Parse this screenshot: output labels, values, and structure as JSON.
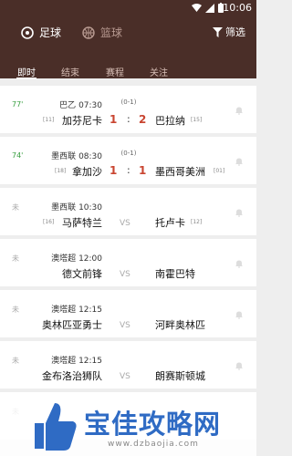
{
  "status_bar": {
    "time": "10:06"
  },
  "header": {
    "sports": [
      {
        "label": "足球",
        "active": true
      },
      {
        "label": "篮球",
        "active": false
      }
    ],
    "filter_label": "筛选"
  },
  "tabs": [
    {
      "label": "即时",
      "active": true
    },
    {
      "label": "结束",
      "active": false
    },
    {
      "label": "赛程",
      "active": false
    },
    {
      "label": "关注",
      "active": false
    }
  ],
  "matches": [
    {
      "status": "77'",
      "live": true,
      "league": "巴乙",
      "time": "07:30",
      "half_score": "(0-1)",
      "home_rank": "[11]",
      "home": "加芬尼卡",
      "home_score": "1",
      "away_score": "2",
      "away": "巴拉纳",
      "away_rank": "[15]"
    },
    {
      "status": "74'",
      "live": true,
      "league": "墨西联",
      "time": "08:30",
      "half_score": "(0-1)",
      "home_rank": "[18]",
      "home": "拿加沙",
      "home_score": "1",
      "away_score": "1",
      "away": "墨西哥美洲",
      "away_rank": "[01]"
    },
    {
      "status": "未",
      "live": false,
      "league": "墨西联",
      "time": "10:30",
      "half_score": "",
      "home_rank": "[16]",
      "home": "马萨特兰",
      "vs": "VS",
      "away": "托卢卡",
      "away_rank": "[12]"
    },
    {
      "status": "未",
      "live": false,
      "league": "澳塔超",
      "time": "12:00",
      "half_score": "",
      "home_rank": "",
      "home": "德文前锋",
      "vs": "VS",
      "away": "南霍巴特",
      "away_rank": ""
    },
    {
      "status": "未",
      "live": false,
      "league": "澳塔超",
      "time": "12:15",
      "half_score": "",
      "home_rank": "",
      "home": "奥林匹亚勇士",
      "vs": "VS",
      "away": "河畔奥林匹",
      "away_rank": ""
    },
    {
      "status": "未",
      "live": false,
      "league": "澳塔超",
      "time": "12:15",
      "half_score": "",
      "home_rank": "",
      "home": "金布洛治狮队",
      "vs": "VS",
      "away": "朗赛斯顿城",
      "away_rank": ""
    },
    {
      "status": "未",
      "live": false,
      "league": "",
      "time": "",
      "half_score": "",
      "home_rank": "",
      "home": "",
      "vs": "",
      "away": "",
      "away_rank": ""
    }
  ],
  "watermark": {
    "title": "宝佳攻略网",
    "url": "www.dzbaojia.com"
  },
  "colors": {
    "header_bg": "#4a2e28",
    "live_green": "#3aa042",
    "score_red": "#c94531",
    "watermark_blue": "#2f6bc4"
  }
}
